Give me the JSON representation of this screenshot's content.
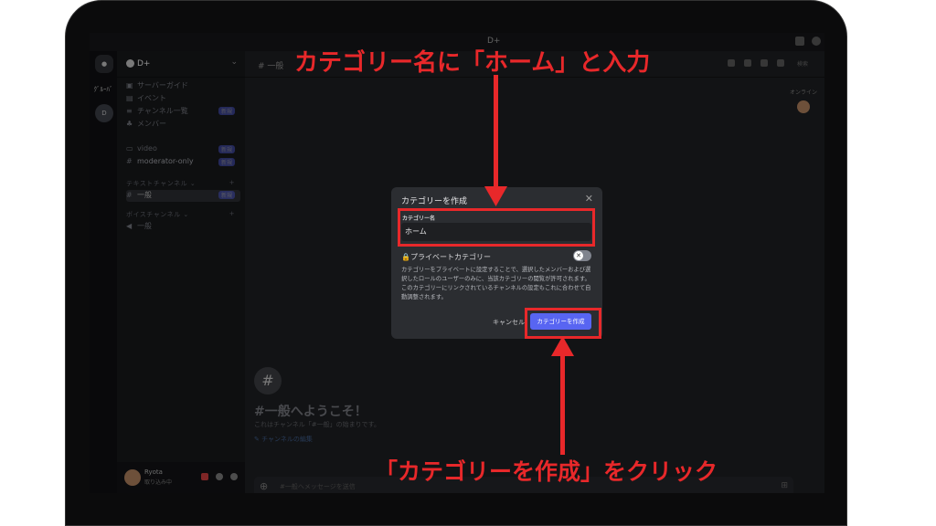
{
  "window": {
    "title": "D+"
  },
  "server": {
    "name": "D+"
  },
  "guilds": {
    "items": [
      "ｸﾞﾙｰﾊﾞ",
      "D"
    ]
  },
  "sidebar": {
    "items": [
      {
        "icon": "guide",
        "label": "サーバーガイド"
      },
      {
        "icon": "calendar",
        "label": "イベント"
      },
      {
        "icon": "list",
        "label": "チャンネル一覧",
        "badge": "新規"
      },
      {
        "icon": "members",
        "label": "メンバー"
      },
      {
        "icon": "voice",
        "label": "video",
        "badge": "新規"
      },
      {
        "icon": "hash",
        "label": "moderator-only",
        "badge": "新規"
      }
    ],
    "categories": [
      {
        "label": "テキストチャンネル"
      },
      {
        "label": "ボイスチャンネル"
      }
    ],
    "text_channels": [
      {
        "label": "一般",
        "badge": "新規"
      }
    ],
    "voice_channels": [
      {
        "label": "一般"
      }
    ]
  },
  "user": {
    "name": "Ryota",
    "status": "取り込み中"
  },
  "channel": {
    "name": "一般"
  },
  "welcome": {
    "title": "#一般へようこそ！",
    "subtitle": "これはチャンネル「#一般」の始まりです。",
    "edit_link": "チャンネルの編集"
  },
  "composer": {
    "placeholder": "#一般へメッセージを送信"
  },
  "member_list": {
    "header": "オンライン"
  },
  "search": {
    "placeholder": "検索"
  },
  "modal": {
    "title": "カテゴリーを作成",
    "field_label": "カテゴリー名",
    "field_value": "ホーム",
    "private_label": "プライベートカテゴリー",
    "description": "カテゴリーをプライベートに設定することで、選択したメンバーおよび選択したロールのユーザーのみに、当該カテゴリーの閲覧が許可されます。このカテゴリーにリンクされているチャンネルの設定もこれに合わせて自動調整されます。",
    "cancel_label": "キャンセル",
    "create_label": "カテゴリーを作成"
  },
  "annotations": {
    "top": "カテゴリー名に「ホーム」と入力",
    "bottom": "「カテゴリーを作成」をクリック",
    "color": "#e8282a"
  },
  "colors": {
    "accent": "#5865f2",
    "annotation": "#e8282a",
    "background": "#1d1e21"
  }
}
